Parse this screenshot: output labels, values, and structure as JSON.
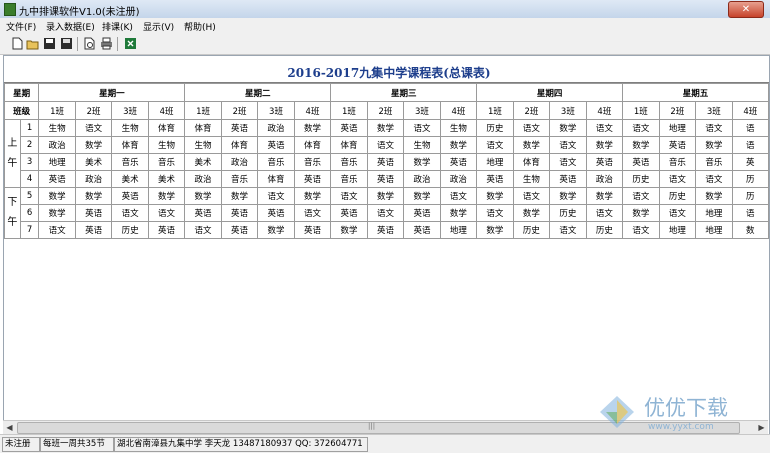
{
  "window": {
    "title": "九中排课软件V1.0(未注册)",
    "close_label": "✕"
  },
  "menu": [
    "文件(F)",
    "录入数据(E)",
    "排课(K)",
    "显示(V)",
    "帮助(H)"
  ],
  "toolbar": [
    "new-icon",
    "open-icon",
    "save-icon",
    "save-all-icon",
    "print-preview-icon",
    "print-icon",
    "excel-icon"
  ],
  "schedule": {
    "title": "2016-2017九集中学课程表(总课表)",
    "day_label": "星期",
    "class_label": "班级",
    "days": [
      "星期一",
      "星期二",
      "星期三",
      "星期四",
      "星期五"
    ],
    "classes": [
      "1班",
      "2班",
      "3班",
      "4班"
    ],
    "sessions": [
      {
        "label": "上\n午",
        "chars": [
          "上",
          "午"
        ]
      },
      {
        "label": "下\n午",
        "chars": [
          "下",
          "午"
        ]
      }
    ],
    "periods": [
      "1",
      "2",
      "3",
      "4",
      "5",
      "6",
      "7"
    ],
    "rows": [
      [
        "生物",
        "语文",
        "生物",
        "体育",
        "体育",
        "英语",
        "政治",
        "数学",
        "英语",
        "数学",
        "语文",
        "生物",
        "历史",
        "语文",
        "数学",
        "语文",
        "语文",
        "地理",
        "语文",
        "语"
      ],
      [
        "政治",
        "数学",
        "体育",
        "生物",
        "生物",
        "体育",
        "英语",
        "体育",
        "体育",
        "语文",
        "生物",
        "数学",
        "语文",
        "数学",
        "语文",
        "数学",
        "数学",
        "英语",
        "数学",
        "语"
      ],
      [
        "地理",
        "美术",
        "音乐",
        "音乐",
        "美术",
        "政治",
        "音乐",
        "音乐",
        "音乐",
        "英语",
        "数学",
        "英语",
        "地理",
        "体育",
        "语文",
        "英语",
        "英语",
        "音乐",
        "音乐",
        "英"
      ],
      [
        "英语",
        "政治",
        "美术",
        "美术",
        "政治",
        "音乐",
        "体育",
        "英语",
        "音乐",
        "英语",
        "政治",
        "政治",
        "英语",
        "生物",
        "英语",
        "政治",
        "历史",
        "语文",
        "语文",
        "历"
      ],
      [
        "数学",
        "数学",
        "英语",
        "数学",
        "数学",
        "数学",
        "语文",
        "数学",
        "语文",
        "数学",
        "数学",
        "语文",
        "数学",
        "语文",
        "数学",
        "数学",
        "语文",
        "历史",
        "数学",
        "历"
      ],
      [
        "数学",
        "英语",
        "语文",
        "语文",
        "英语",
        "英语",
        "英语",
        "语文",
        "英语",
        "语文",
        "英语",
        "数学",
        "语文",
        "数学",
        "历史",
        "语文",
        "数学",
        "语文",
        "地理",
        "语"
      ],
      [
        "语文",
        "英语",
        "历史",
        "英语",
        "语文",
        "英语",
        "数学",
        "英语",
        "数学",
        "英语",
        "英语",
        "地理",
        "数学",
        "历史",
        "语文",
        "历史",
        "语文",
        "地理",
        "地理",
        "数"
      ]
    ]
  },
  "status": {
    "registration": "未注册",
    "weekly_periods": "每班一周共35节",
    "contact": "湖北省南漳县九集中学 李天龙 13487180937 QQ: 372604771"
  },
  "watermark": {
    "text": "优优下载",
    "url": "www.yyxt.com"
  },
  "colors": {
    "title_blue": "#1d3e8c",
    "grid": "#9a9a9a",
    "chrome": "#f0f0f0"
  }
}
